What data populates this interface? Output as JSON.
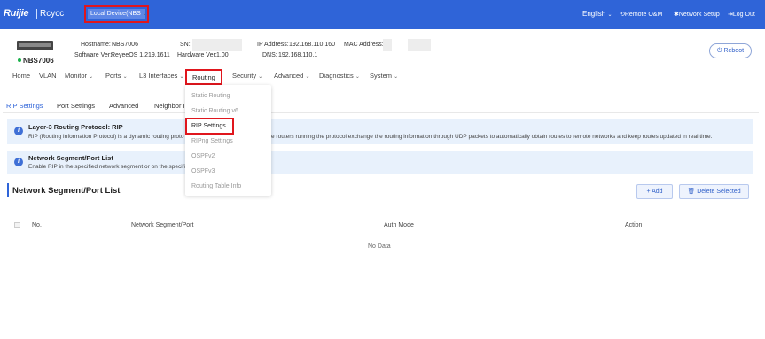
{
  "topbar": {
    "logo": "Ruijie",
    "logo_sub": "Rcycc",
    "device_selector": "Local Device(NBS",
    "language": "English",
    "remote_om": "Remote O&M",
    "network_setup": "Network Setup",
    "logout": "Log Out"
  },
  "device": {
    "image_label": "Switch",
    "model": "NBS7006",
    "hostname_label": "Hostname:",
    "hostname": "NBS7006",
    "software_label": "Software Ver:",
    "software": "ReyeeOS 1.219.1611",
    "sn_label": "SN:",
    "hardware_label": "Hardware Ver:",
    "hardware": "1.00",
    "ip_label": "IP Address:",
    "ip": "192.168.110.160",
    "dns_label": "DNS:",
    "dns": "192.168.110.1",
    "mac_label": "MAC Address:",
    "reboot": "Reboot"
  },
  "nav": {
    "home": "Home",
    "vlan": "VLAN",
    "monitor": "Monitor",
    "ports": "Ports",
    "l3": "L3 Interfaces",
    "routing": "Routing",
    "security": "Security",
    "advanced": "Advanced",
    "diagnostics": "Diagnostics",
    "system": "System"
  },
  "routing_menu": {
    "static": "Static Routing",
    "static_v6": "Static Routing v6",
    "rip": "RIP Settings",
    "ripng": "RIPng Settings",
    "ospfv2": "OSPFv2",
    "ospfv3": "OSPFv3",
    "table": "Routing Table Info"
  },
  "tabs": {
    "rip": "RIP Settings",
    "port": "Port Settings",
    "advanced": "Advanced",
    "neighbor": "Neighbor In"
  },
  "banner1": {
    "title": "Layer-3 Routing Protocol: RIP",
    "text_left": "RIP (Routing Information Protocol) is a dynamic routing proto",
    "text_right": "e routers running the protocol exchange the routing information through UDP packets to automatically obtain routes to remote networks and keep routes updated in real time."
  },
  "banner2": {
    "title": "Network Segment/Port List",
    "text": "Enable RIP in the specified network segment or on the specifi"
  },
  "section": {
    "title": "Network Segment/Port List",
    "add": "+ Add",
    "delete": "Delete Selected"
  },
  "table": {
    "headers": [
      "No.",
      "Network Segment/Port",
      "Auth Mode",
      "Action"
    ],
    "empty": "No Data"
  },
  "colors": {
    "topbar": "#2f64d8",
    "highlight": "#e0161d",
    "accent": "#2f64d8"
  }
}
